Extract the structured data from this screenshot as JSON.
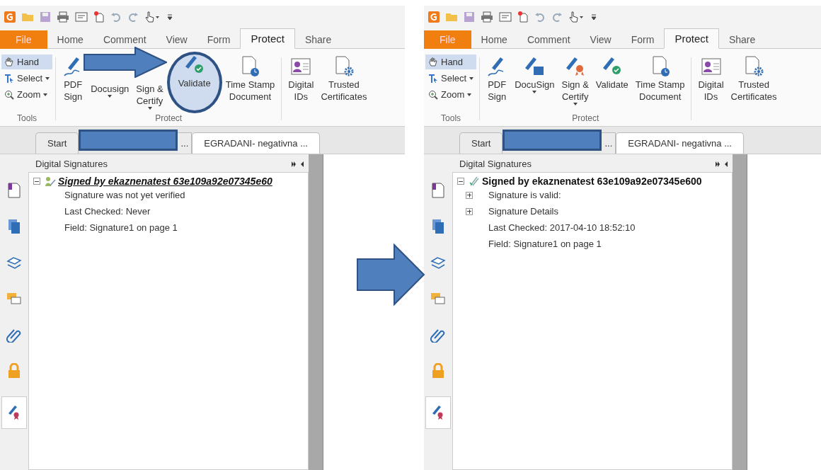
{
  "windows": [
    {
      "menu_tabs": [
        {
          "label": "File",
          "kind": "file",
          "selected": false
        },
        {
          "label": "Home",
          "kind": "tab",
          "selected": false
        },
        {
          "label": "Comment",
          "kind": "tab",
          "selected": false
        },
        {
          "label": "View",
          "kind": "tab",
          "selected": false
        },
        {
          "label": "Form",
          "kind": "tab",
          "selected": false
        },
        {
          "label": "Protect",
          "kind": "tab",
          "selected": true
        },
        {
          "label": "Share",
          "kind": "tab",
          "selected": false
        }
      ],
      "small_tools": [
        {
          "label": "Hand",
          "kind": "hand",
          "selected": true,
          "dropdown": false
        },
        {
          "label": "Select",
          "kind": "select",
          "selected": false,
          "dropdown": true
        },
        {
          "label": "Zoom",
          "kind": "zoom",
          "selected": false,
          "dropdown": true
        }
      ],
      "tools_group": "Tools",
      "protect_tools": [
        {
          "label": "PDF\nSign",
          "kind": "sign",
          "dropdown": false,
          "highlighted": false,
          "covered": false
        },
        {
          "label": "Docusign",
          "dropdown": true,
          "highlighted": false,
          "covered": true
        },
        {
          "label": "Sign &\nCertify",
          "dropdown": true,
          "highlighted": false,
          "covered": true
        },
        {
          "label": "Validate",
          "kind": "validate",
          "dropdown": false,
          "highlighted": true,
          "covered": false
        },
        {
          "label": "Time Stamp\nDocument",
          "kind": "timestamp",
          "dropdown": false,
          "highlighted": false,
          "covered": false
        }
      ],
      "protect_group": "Protect",
      "extra_tools": [
        {
          "label": "Digital\nIDs",
          "kind": "ids",
          "dropdown": false,
          "highlighted": false
        },
        {
          "label": "Trusted\nCertificates",
          "kind": "trusted",
          "dropdown": false,
          "highlighted": false
        }
      ],
      "doc_tabs": [
        {
          "label": "Start",
          "redacted": false,
          "selected": false
        },
        {
          "label": "...",
          "redacted": true,
          "selected": false
        },
        {
          "label": "EGRADANI- negativna ...",
          "redacted": false,
          "selected": true
        }
      ],
      "panel_title": "Digital Signatures",
      "signature": {
        "label": "Signed by ekaznenatest 63e109a92e07345e60",
        "verified": false,
        "expanded": true,
        "children": [
          {
            "label": "Signature was not yet verified",
            "expandable": false
          },
          {
            "label": "Last Checked: Never",
            "expandable": false
          },
          {
            "label": "Field: Signature1 on page 1",
            "expandable": false
          }
        ]
      },
      "sidebar_tabs": [
        {
          "selected": false
        },
        {
          "selected": false
        },
        {
          "selected": false
        },
        {
          "selected": false
        },
        {
          "selected": false
        },
        {
          "selected": false
        },
        {
          "selected": true
        }
      ]
    },
    {
      "menu_tabs": [
        {
          "label": "File",
          "kind": "file",
          "selected": false
        },
        {
          "label": "Home",
          "kind": "tab",
          "selected": false
        },
        {
          "label": "Comment",
          "kind": "tab",
          "selected": false
        },
        {
          "label": "View",
          "kind": "tab",
          "selected": false
        },
        {
          "label": "Form",
          "kind": "tab",
          "selected": false
        },
        {
          "label": "Protect",
          "kind": "tab",
          "selected": true
        },
        {
          "label": "Share",
          "kind": "tab",
          "selected": false
        }
      ],
      "small_tools": [
        {
          "label": "Hand",
          "kind": "hand",
          "selected": true,
          "dropdown": false
        },
        {
          "label": "Select",
          "kind": "select",
          "selected": false,
          "dropdown": true
        },
        {
          "label": "Zoom",
          "kind": "zoom",
          "selected": false,
          "dropdown": true
        }
      ],
      "tools_group": "Tools",
      "protect_tools": [
        {
          "label": "PDF\nSign",
          "kind": "sign",
          "dropdown": false,
          "highlighted": false,
          "covered": false
        },
        {
          "label": "DocuSign",
          "kind": "docusign",
          "dropdown": true,
          "highlighted": false,
          "covered": false
        },
        {
          "label": "Sign &\nCertify",
          "kind": "certify",
          "dropdown": true,
          "highlighted": false,
          "covered": false
        },
        {
          "label": "Validate",
          "kind": "validate",
          "dropdown": false,
          "highlighted": false,
          "covered": false
        },
        {
          "label": "Time Stamp\nDocument",
          "kind": "timestamp",
          "dropdown": false,
          "highlighted": false,
          "covered": false
        }
      ],
      "protect_group": "Protect",
      "extra_tools": [
        {
          "label": "Digital\nIDs",
          "kind": "ids",
          "dropdown": false,
          "highlighted": false
        },
        {
          "label": "Trusted\nCertificates",
          "kind": "trusted",
          "dropdown": false,
          "highlighted": false
        }
      ],
      "doc_tabs": [
        {
          "label": "Start",
          "redacted": false,
          "selected": false
        },
        {
          "label": "...",
          "redacted": true,
          "selected": false
        },
        {
          "label": "EGRADANI- negativna ...",
          "redacted": false,
          "selected": true
        }
      ],
      "panel_title": "Digital Signatures",
      "signature": {
        "label": "Signed by ekaznenatest 63e109a92e07345e600",
        "verified": true,
        "expanded": true,
        "children": [
          {
            "label": "Signature is valid:",
            "expandable": true
          },
          {
            "label": "Signature Details",
            "expandable": true
          },
          {
            "label": "Last Checked: 2017-04-10 18:52:10",
            "expandable": false
          },
          {
            "label": "Field: Signature1 on page 1",
            "expandable": false
          }
        ]
      },
      "sidebar_tabs": [
        {
          "selected": false
        },
        {
          "selected": false
        },
        {
          "selected": false
        },
        {
          "selected": false
        },
        {
          "selected": false
        },
        {
          "selected": false
        },
        {
          "selected": true
        }
      ]
    }
  ],
  "callout_arrow": true,
  "between_arrow": true
}
